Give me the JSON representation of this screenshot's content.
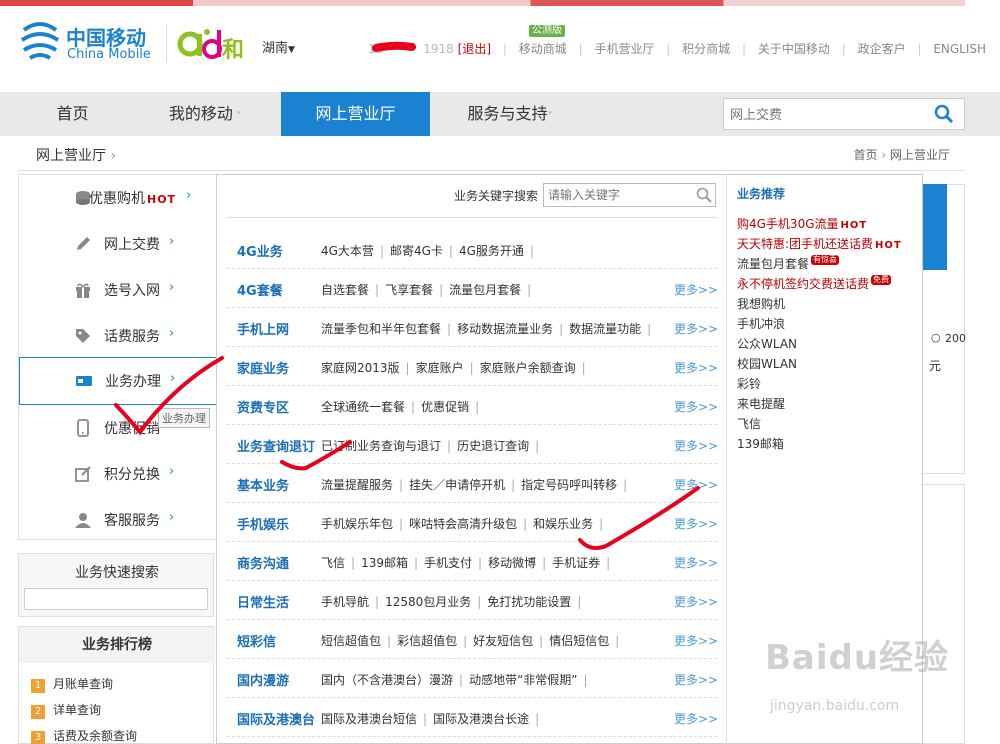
{
  "header": {
    "brand_cn": "中国移动",
    "brand_en": "China Mobile",
    "brand2_name": "和",
    "region": "湖南",
    "user_phone": "1918",
    "logout_label": "[退出]",
    "beta_tag": "公测版",
    "links": [
      "移动商城",
      "手机营业厅",
      "积分商城",
      "关于中国移动",
      "政企客户",
      "ENGLISH"
    ]
  },
  "mainnav": {
    "items": [
      "首页",
      "我的移动",
      "网上营业厅",
      "服务与支持"
    ],
    "search_placeholder": "网上交费"
  },
  "breadcrumb": {
    "title": "网上营业厅",
    "path": [
      "首页",
      "网上营业厅"
    ]
  },
  "leftmenu": {
    "items": [
      {
        "label": "优惠购机",
        "tag": "HOT"
      },
      {
        "label": "网上交费"
      },
      {
        "label": "选号入网"
      },
      {
        "label": "话费服务"
      },
      {
        "label": "业务办理"
      },
      {
        "label": "优惠促销"
      },
      {
        "label": "积分兑换"
      },
      {
        "label": "客服服务"
      }
    ],
    "tooltip": "业务办理"
  },
  "quick_search": {
    "title": "业务快速搜索"
  },
  "ranking": {
    "title": "业务排行榜",
    "items": [
      {
        "num": "1",
        "label": "月账单查询"
      },
      {
        "num": "2",
        "label": "详单查询"
      },
      {
        "num": "3",
        "label": "话费及余额查询"
      }
    ]
  },
  "dropdown": {
    "keyword_label": "业务关键字搜索",
    "keyword_placeholder": "请输入关键字",
    "more_label": "更多>>",
    "rows": [
      {
        "cat": "4G业务",
        "links": [
          "4G大本营",
          "邮寄4G卡",
          "4G服务开通"
        ],
        "more": false
      },
      {
        "cat": "4G套餐",
        "links": [
          "自选套餐",
          "飞享套餐",
          "流量包月套餐"
        ],
        "more": true
      },
      {
        "cat": "手机上网",
        "links": [
          "流量季包和半年包套餐",
          "移动数据流量业务",
          "数据流量功能"
        ],
        "more": true
      },
      {
        "cat": "家庭业务",
        "links": [
          "家庭网2013版",
          "家庭账户",
          "家庭账户余额查询"
        ],
        "more": true
      },
      {
        "cat": "资费专区",
        "links": [
          "全球通统一套餐",
          "优惠促销"
        ],
        "more": true
      },
      {
        "cat": "业务查询退订",
        "links": [
          "已订制业务查询与退订",
          "历史退订查询"
        ],
        "more": true
      },
      {
        "cat": "基本业务",
        "links": [
          "流量提醒服务",
          "挂失／申请停开机",
          "指定号码呼叫转移"
        ],
        "more": true
      },
      {
        "cat": "手机娱乐",
        "links": [
          "手机娱乐年包",
          "咪咕特会高清升级包",
          "和娱乐业务"
        ],
        "more": true
      },
      {
        "cat": "商务沟通",
        "links": [
          "飞信",
          "139邮箱",
          "手机支付",
          "移动微博",
          "手机证券"
        ],
        "more": true
      },
      {
        "cat": "日常生活",
        "links": [
          "手机导航",
          "12580包月业务",
          "免打扰功能设置"
        ],
        "more": true
      },
      {
        "cat": "短彩信",
        "links": [
          "短信超值包",
          "彩信超值包",
          "好友短信包",
          "情侣短信包"
        ],
        "more": true
      },
      {
        "cat": "国内漫游",
        "links": [
          "国内（不含港澳台）漫游",
          "动感地带“非常假期”"
        ],
        "more": true
      },
      {
        "cat": "国际及港澳台",
        "links": [
          "国际及港澳台短信",
          "国际及港澳台长途"
        ],
        "more": true
      }
    ],
    "recommend_title": "业务推荐",
    "recommend": [
      {
        "label": "购4G手机30G流量",
        "tag": "HOT",
        "color": "#c00000"
      },
      {
        "label": "天天特惠:团手机还送话费",
        "tag": "HOT",
        "color": "#c00000"
      },
      {
        "label": "流量包月套餐",
        "badge": "有惊喜",
        "color": "#333333"
      },
      {
        "label": "永不停机签约交费送话费",
        "badge": "免费",
        "color": "#c00000"
      },
      {
        "label": "我想购机",
        "color": "#333333"
      },
      {
        "label": "手机冲浪",
        "color": "#333333"
      },
      {
        "label": "公众WLAN",
        "color": "#333333"
      },
      {
        "label": "校园WLAN",
        "color": "#333333"
      },
      {
        "label": "彩铃",
        "color": "#333333"
      },
      {
        "label": "来电提醒",
        "color": "#333333"
      },
      {
        "label": "飞信",
        "color": "#333333"
      },
      {
        "label": "139邮箱",
        "color": "#333333"
      }
    ]
  },
  "right_panel": {
    "text_200": "200",
    "text_yuan": "元"
  },
  "watermark": {
    "brand": "Baidu经验",
    "url": "jingyan.baidu.com"
  },
  "colors": {
    "accent": "#1a82d0",
    "hot": "#c00000",
    "annotation": "#e8001c"
  }
}
